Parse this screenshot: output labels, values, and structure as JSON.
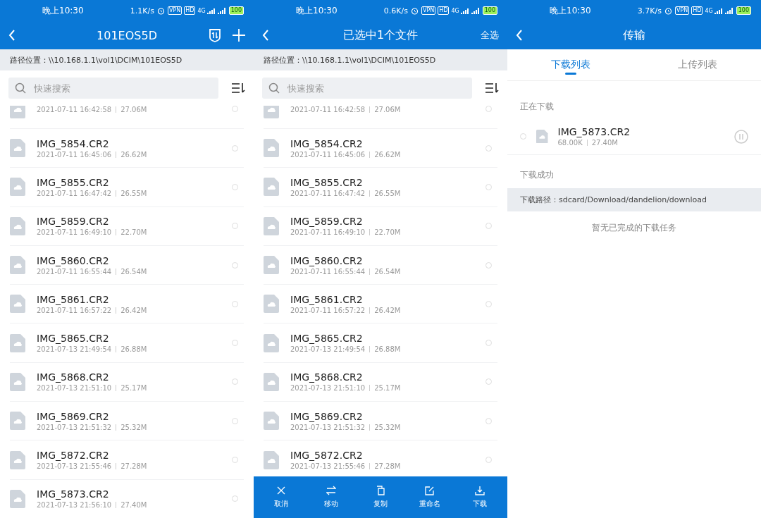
{
  "screens": [
    {
      "kind": "browser",
      "status": {
        "time": "晚上10:30",
        "speed": "1.1K/s",
        "badges": [
          "VPN",
          "HD"
        ],
        "network": "4G",
        "battery": "100"
      },
      "header": {
        "title": "101EOS5D",
        "icons": [
          {
            "kind": "transfer"
          },
          {
            "kind": "add"
          }
        ]
      },
      "path": "路径位置：\\\\10.168.1.1\\vol1\\DCIM\\101EOS5D",
      "search": {
        "placeholder": "快速搜索"
      },
      "files": [
        {
          "date": "2021-07-11 16:42:58",
          "size": "27.06M",
          "selected": false
        },
        {
          "name": "IMG_5854.CR2",
          "date": "2021-07-11 16:45:06",
          "size": "26.62M",
          "selected": false
        },
        {
          "name": "IMG_5855.CR2",
          "date": "2021-07-11 16:47:42",
          "size": "26.55M",
          "selected": false
        },
        {
          "name": "IMG_5859.CR2",
          "date": "2021-07-11 16:49:10",
          "size": "22.70M",
          "selected": false
        },
        {
          "name": "IMG_5860.CR2",
          "date": "2021-07-11 16:55:44",
          "size": "26.54M",
          "selected": false
        },
        {
          "name": "IMG_5861.CR2",
          "date": "2021-07-11 16:57:22",
          "size": "26.42M",
          "selected": false
        },
        {
          "name": "IMG_5865.CR2",
          "date": "2021-07-13 21:49:54",
          "size": "26.88M",
          "selected": false
        },
        {
          "name": "IMG_5868.CR2",
          "date": "2021-07-13 21:51:10",
          "size": "25.17M",
          "selected": false
        },
        {
          "name": "IMG_5869.CR2",
          "date": "2021-07-13 21:51:32",
          "size": "25.32M",
          "selected": false
        },
        {
          "name": "IMG_5872.CR2",
          "date": "2021-07-13 21:55:46",
          "size": "27.28M",
          "selected": false
        },
        {
          "name": "IMG_5873.CR2",
          "date": "2021-07-13 21:56:10",
          "size": "27.40M",
          "selected": false
        }
      ]
    },
    {
      "kind": "browser",
      "status": {
        "time": "晚上10:30",
        "speed": "0.6K/s",
        "badges": [
          "VPN",
          "HD"
        ],
        "network": "4G",
        "battery": "100"
      },
      "header": {
        "title": "已选中1个文件",
        "action": "全选"
      },
      "path": "路径位置：\\\\10.168.1.1\\vol1\\DCIM\\101EOS5D",
      "search": {
        "placeholder": "快速搜索"
      },
      "files": [
        {
          "date": "2021-07-11 16:42:58",
          "size": "27.06M",
          "selected": false
        },
        {
          "name": "IMG_5854.CR2",
          "date": "2021-07-11 16:45:06",
          "size": "26.62M",
          "selected": false
        },
        {
          "name": "IMG_5855.CR2",
          "date": "2021-07-11 16:47:42",
          "size": "26.55M",
          "selected": false
        },
        {
          "name": "IMG_5859.CR2",
          "date": "2021-07-11 16:49:10",
          "size": "22.70M",
          "selected": false
        },
        {
          "name": "IMG_5860.CR2",
          "date": "2021-07-11 16:55:44",
          "size": "26.54M",
          "selected": false
        },
        {
          "name": "IMG_5861.CR2",
          "date": "2021-07-11 16:57:22",
          "size": "26.42M",
          "selected": false
        },
        {
          "name": "IMG_5865.CR2",
          "date": "2021-07-13 21:49:54",
          "size": "26.88M",
          "selected": false
        },
        {
          "name": "IMG_5868.CR2",
          "date": "2021-07-13 21:51:10",
          "size": "25.17M",
          "selected": false
        },
        {
          "name": "IMG_5869.CR2",
          "date": "2021-07-13 21:51:32",
          "size": "25.32M",
          "selected": false
        },
        {
          "name": "IMG_5872.CR2",
          "date": "2021-07-13 21:55:46",
          "size": "27.28M",
          "selected": false
        }
      ],
      "toolbar": [
        {
          "kind": "cancel",
          "label": "取消"
        },
        {
          "kind": "move",
          "label": "移动"
        },
        {
          "kind": "copy",
          "label": "复制"
        },
        {
          "kind": "rename",
          "label": "重命名"
        },
        {
          "kind": "download",
          "label": "下载"
        }
      ]
    },
    {
      "kind": "transfer",
      "status": {
        "time": "晚上10:30",
        "speed": "3.7K/s",
        "badges": [
          "VPN",
          "HD"
        ],
        "network": "4G",
        "battery": "100"
      },
      "header": {
        "title": "传输"
      },
      "tabs": [
        {
          "label": "下载列表",
          "selected": true
        },
        {
          "label": "上传列表",
          "selected": false
        }
      ],
      "downloading": {
        "label": "正在下载",
        "items": [
          {
            "name": "IMG_5873.CR2",
            "downloaded": "68.00K",
            "size": "27.40M",
            "selected": false
          }
        ]
      },
      "finished": {
        "label": "下载成功",
        "path": "下载路径：sdcard/Download/dandelion/download",
        "empty": "暂无已完成的下载任务"
      }
    }
  ]
}
